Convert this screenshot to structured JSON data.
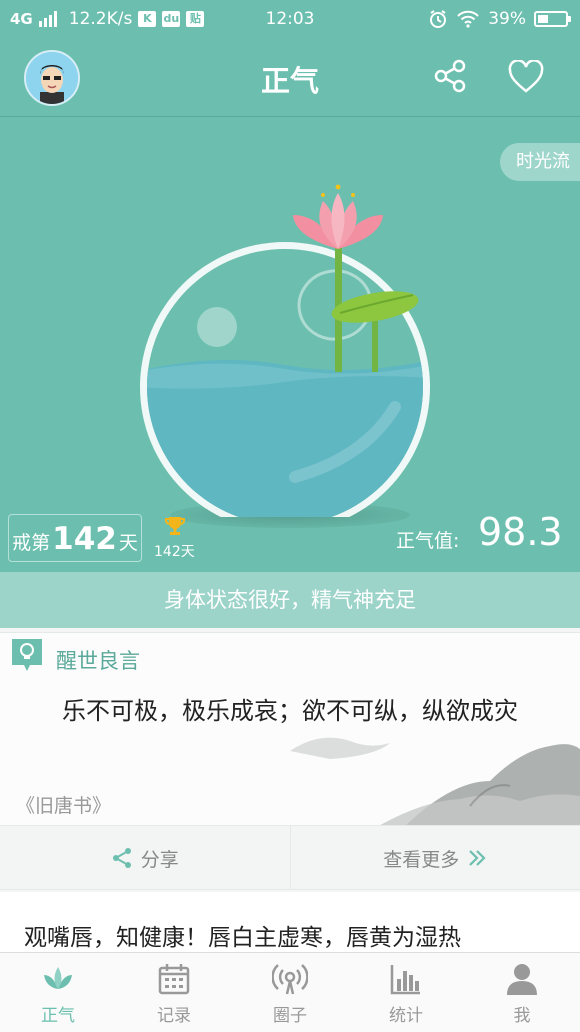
{
  "status_bar": {
    "network": "4G",
    "speed": "12.2K/s",
    "app_badges": [
      "K",
      "du",
      "贴"
    ],
    "time": "12:03",
    "battery": "39%"
  },
  "header": {
    "title": "正气"
  },
  "hero": {
    "timeline_label": "时光流",
    "streak_prefix": "戒第",
    "streak_days": "142",
    "streak_suffix": "天",
    "best_record": "142天",
    "score_label": "正气值:",
    "score_value": "98.3"
  },
  "status_message": "身体状态很好，精气神充足",
  "quote_card": {
    "heading": "醒世良言",
    "text": "乐不可极，极乐成哀；欲不可纵，纵欲成灾",
    "source": "《旧唐书》",
    "share_label": "分享",
    "more_label": "查看更多"
  },
  "tip": {
    "text": "观嘴唇，知健康！唇白主虚寒，唇黄为湿热"
  },
  "nav": {
    "items": [
      {
        "label": "正气",
        "icon": "lotus-icon"
      },
      {
        "label": "记录",
        "icon": "calendar-icon"
      },
      {
        "label": "圈子",
        "icon": "broadcast-icon"
      },
      {
        "label": "统计",
        "icon": "bar-chart-icon"
      },
      {
        "label": "我",
        "icon": "person-icon"
      }
    ],
    "active_index": 0
  },
  "colors": {
    "primary": "#6cbfae",
    "strip": "#9dd4ca",
    "lotus": "#f08a9a",
    "water": "#5fb7c2"
  }
}
